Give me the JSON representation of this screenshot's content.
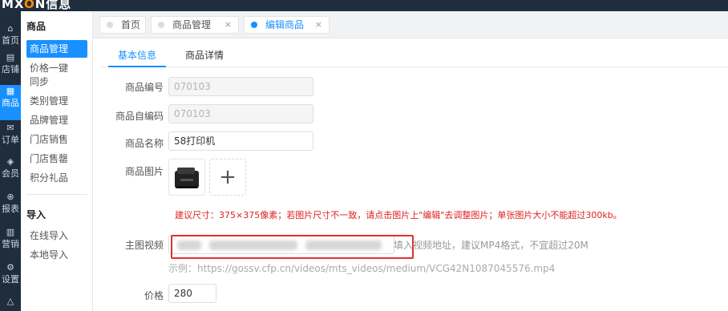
{
  "brand": {
    "prefix": "MX",
    "accent_char": "O",
    "suffix": "N",
    "cn": "信息"
  },
  "rail": [
    {
      "icon": "⌂",
      "label": "首页",
      "icon_name": "home-icon"
    },
    {
      "icon": "▤",
      "label": "店铺",
      "icon_name": "store-icon"
    },
    {
      "icon": "▦",
      "label": "商品",
      "icon_name": "goods-icon"
    },
    {
      "icon": "✉",
      "label": "订单",
      "icon_name": "order-icon"
    },
    {
      "icon": "◈",
      "label": "会员",
      "icon_name": "member-icon"
    },
    {
      "icon": "⊕",
      "label": "报表",
      "icon_name": "report-icon"
    },
    {
      "icon": "▥",
      "label": "营销",
      "icon_name": "marketing-icon"
    },
    {
      "icon": "⚙",
      "label": "设置",
      "icon_name": "settings-icon"
    },
    {
      "icon": "△",
      "label": "",
      "icon_name": "more-icon"
    }
  ],
  "submenu": {
    "group1": "商品",
    "items1": [
      "商品管理",
      "价格一键",
      "同步",
      "类别管理",
      "品牌管理",
      "门店销售",
      "门店售罄",
      "积分礼品"
    ],
    "group2": "导入",
    "items2": [
      "在线导入",
      "本地导入"
    ]
  },
  "tabs": {
    "home": "首页",
    "goods_manage": "商品管理",
    "edit_goods": "编辑商品",
    "close": "×"
  },
  "subtabs": {
    "basic": "基本信息",
    "detail": "商品详情"
  },
  "form": {
    "code_label": "商品编号",
    "code_value": "070103",
    "self_code_label": "商品自编码",
    "self_code_value": "070103",
    "name_label": "商品名称",
    "name_value": "58打印机",
    "image_label": "商品图片",
    "upload_plus": "+",
    "image_hint": "建议尺寸：375×375像素；若图片尺寸不一致，请点击图片上\"编辑\"去调整图片；单张图片大小不能超过300kb。",
    "video_label": "主图视频",
    "video_hint": "填入视频地址，建议MP4格式，不宜超过20M",
    "video_example": "示例：https://gossv.cfp.cn/videos/mts_videos/medium/VCG42N1087045576.mp4",
    "price_label": "价格",
    "price_value": "280"
  },
  "colors": {
    "accent": "#1890ff",
    "danger": "#e02020",
    "rail": "#1f2d3d"
  }
}
